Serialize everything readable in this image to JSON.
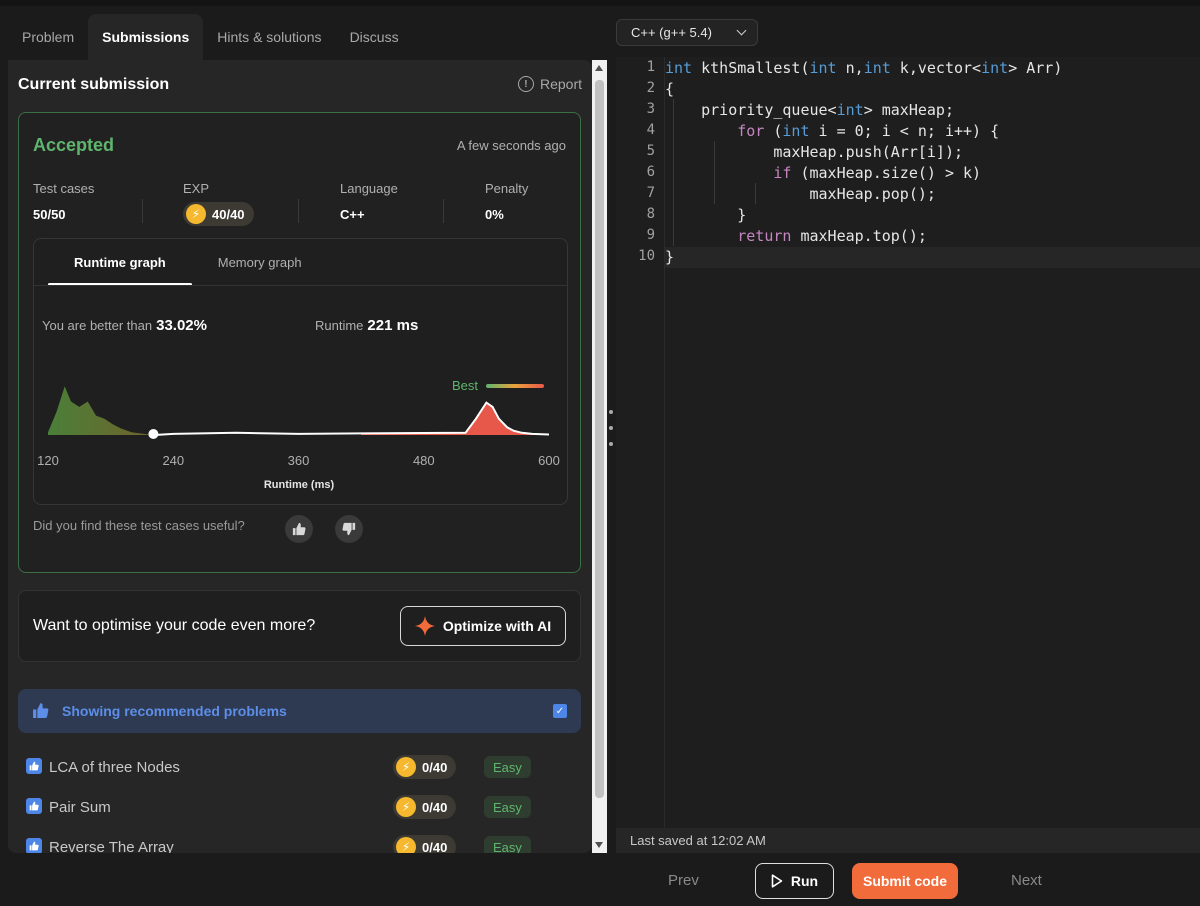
{
  "tabs": [
    {
      "label": "Problem"
    },
    {
      "label": "Submissions"
    },
    {
      "label": "Hints & solutions"
    },
    {
      "label": "Discuss"
    }
  ],
  "submission": {
    "title": "Current submission",
    "report_label": "Report",
    "status": "Accepted",
    "time": "A few seconds ago",
    "stats": {
      "test_cases_label": "Test cases",
      "test_cases_value": "50/50",
      "exp_label": "EXP",
      "exp_value": "40/40",
      "language_label": "Language",
      "language_value": "C++",
      "penalty_label": "Penalty",
      "penalty_value": "0%"
    }
  },
  "graph": {
    "tabs": [
      "Runtime graph",
      "Memory graph"
    ],
    "better_label": "You are better than",
    "better_value": "33.02%",
    "runtime_label": "Runtime",
    "runtime_value": "221 ms",
    "best_label": "Best",
    "feedback_question": "Did you find these test cases useful?"
  },
  "chart_data": {
    "type": "area",
    "xlabel": "Runtime (ms)",
    "ylabel": "",
    "xlim": [
      120,
      600
    ],
    "xticks": [
      "120",
      "240",
      "360",
      "480",
      "600"
    ],
    "x": [
      120,
      128,
      136,
      142,
      150,
      158,
      166,
      174,
      182,
      190,
      200,
      212,
      222,
      240,
      300,
      360,
      420,
      520,
      530,
      540,
      546,
      552,
      560,
      566,
      574,
      584,
      600
    ],
    "y": [
      0.05,
      0.42,
      0.9,
      0.62,
      0.52,
      0.62,
      0.36,
      0.3,
      0.2,
      0.12,
      0.05,
      0.02,
      0.0,
      0.02,
      0.04,
      0.02,
      0.03,
      0.04,
      0.3,
      0.6,
      0.52,
      0.3,
      0.14,
      0.08,
      0.04,
      0.02,
      0.01
    ],
    "marker_x": 221,
    "colors": {
      "slow": "#e8584a",
      "fast": "#5fb56d",
      "line": "#ffffff"
    }
  },
  "optimize": {
    "prompt": "Want to optimise your code even more?",
    "button_label": "Optimize with AI"
  },
  "recommended": {
    "label": "Showing recommended problems",
    "problems": [
      {
        "name": "LCA of three Nodes",
        "exp": "0/40",
        "difficulty": "Easy"
      },
      {
        "name": "Pair Sum",
        "exp": "0/40",
        "difficulty": "Easy"
      },
      {
        "name": "Reverse The Array",
        "exp": "0/40",
        "difficulty": "Easy"
      }
    ]
  },
  "editor": {
    "language": "C++ (g++ 5.4)",
    "line_numbers": [
      "1",
      "2",
      "3",
      "4",
      "5",
      "6",
      "7",
      "8",
      "9",
      "10"
    ],
    "last_saved": "Last saved at 12:02 AM"
  },
  "actions": {
    "prev": "Prev",
    "run": "Run",
    "submit": "Submit code",
    "next": "Next"
  },
  "colors": {
    "accent_orange": "#f26b3a",
    "accepted_green": "#5fb56d",
    "link_blue": "#5d8ee8",
    "exp_gold": "#f5b82e"
  }
}
